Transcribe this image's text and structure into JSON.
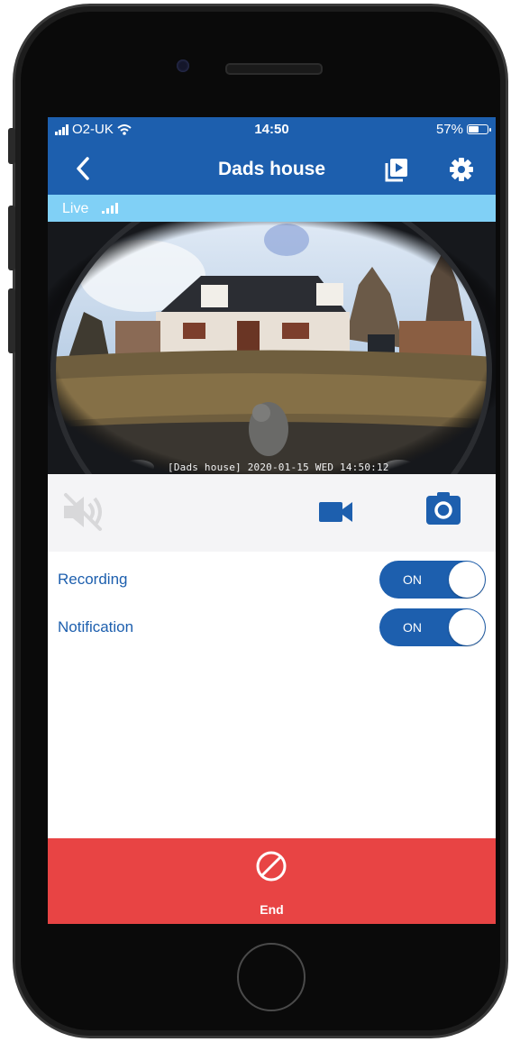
{
  "status_bar": {
    "carrier": "O2-UK",
    "time": "14:50",
    "battery": "57%",
    "battery_level": 0.57,
    "icons": [
      "signal-bars-icon",
      "wifi-icon",
      "battery-icon"
    ]
  },
  "nav": {
    "title": "Dads house",
    "icons": [
      "back-chevron-icon",
      "playlist-icon",
      "gear-icon"
    ]
  },
  "live": {
    "label": "Live",
    "icon": "signal-strength-icon"
  },
  "video": {
    "timestamp": "[Dads house] 2020-01-15 WED 14:50:12"
  },
  "controls": {
    "icons": [
      "speaker-muted-icon",
      "video-camera-icon",
      "camera-icon"
    ]
  },
  "settings": [
    {
      "label": "Recording",
      "toggle": "ON",
      "enabled": true
    },
    {
      "label": "Notification",
      "toggle": "ON",
      "enabled": true
    }
  ],
  "end_button": {
    "label": "End",
    "icon": "prohibited-icon"
  },
  "colors": {
    "primary": "#1d5fae",
    "live_bar": "#80d0f6",
    "end_bar": "#e84444",
    "controls_bg": "#f4f4f6"
  }
}
